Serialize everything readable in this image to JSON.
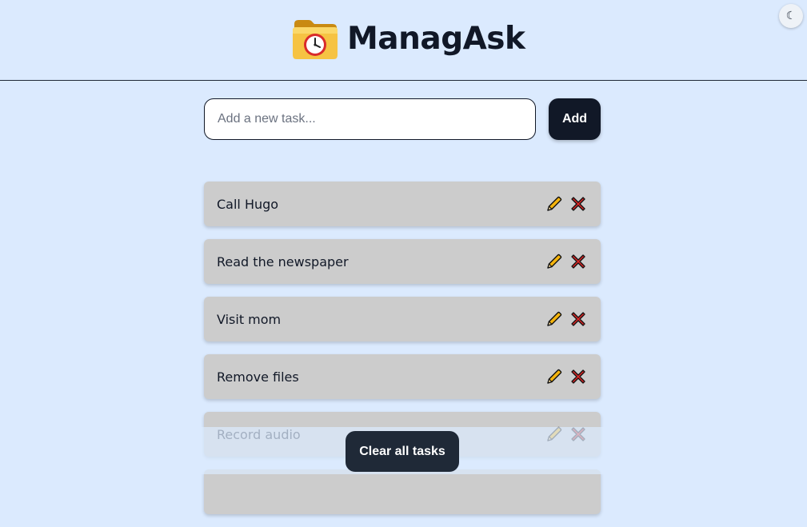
{
  "app": {
    "title": "ManagAsk",
    "logo_icon": "folder-clock-icon"
  },
  "theme_toggle": {
    "icon": "moon-icon",
    "glyph": "☾"
  },
  "new_task": {
    "placeholder": "Add a new task...",
    "value": "",
    "add_label": "Add"
  },
  "tasks": [
    {
      "text": "Call Hugo"
    },
    {
      "text": "Read the newspaper"
    },
    {
      "text": "Visit mom"
    },
    {
      "text": "Remove files"
    },
    {
      "text": "Record audio"
    },
    {
      "text": ""
    }
  ],
  "actions": {
    "edit_icon": "pencil-icon",
    "delete_icon": "red-x-icon"
  },
  "clear_all_label": "Clear all tasks",
  "colors": {
    "background": "#dbeafe",
    "task_bg": "#cccccc",
    "button_dark": "#111827",
    "delete_red": "#dc2626",
    "pencil_yellow": "#f59e0b"
  }
}
